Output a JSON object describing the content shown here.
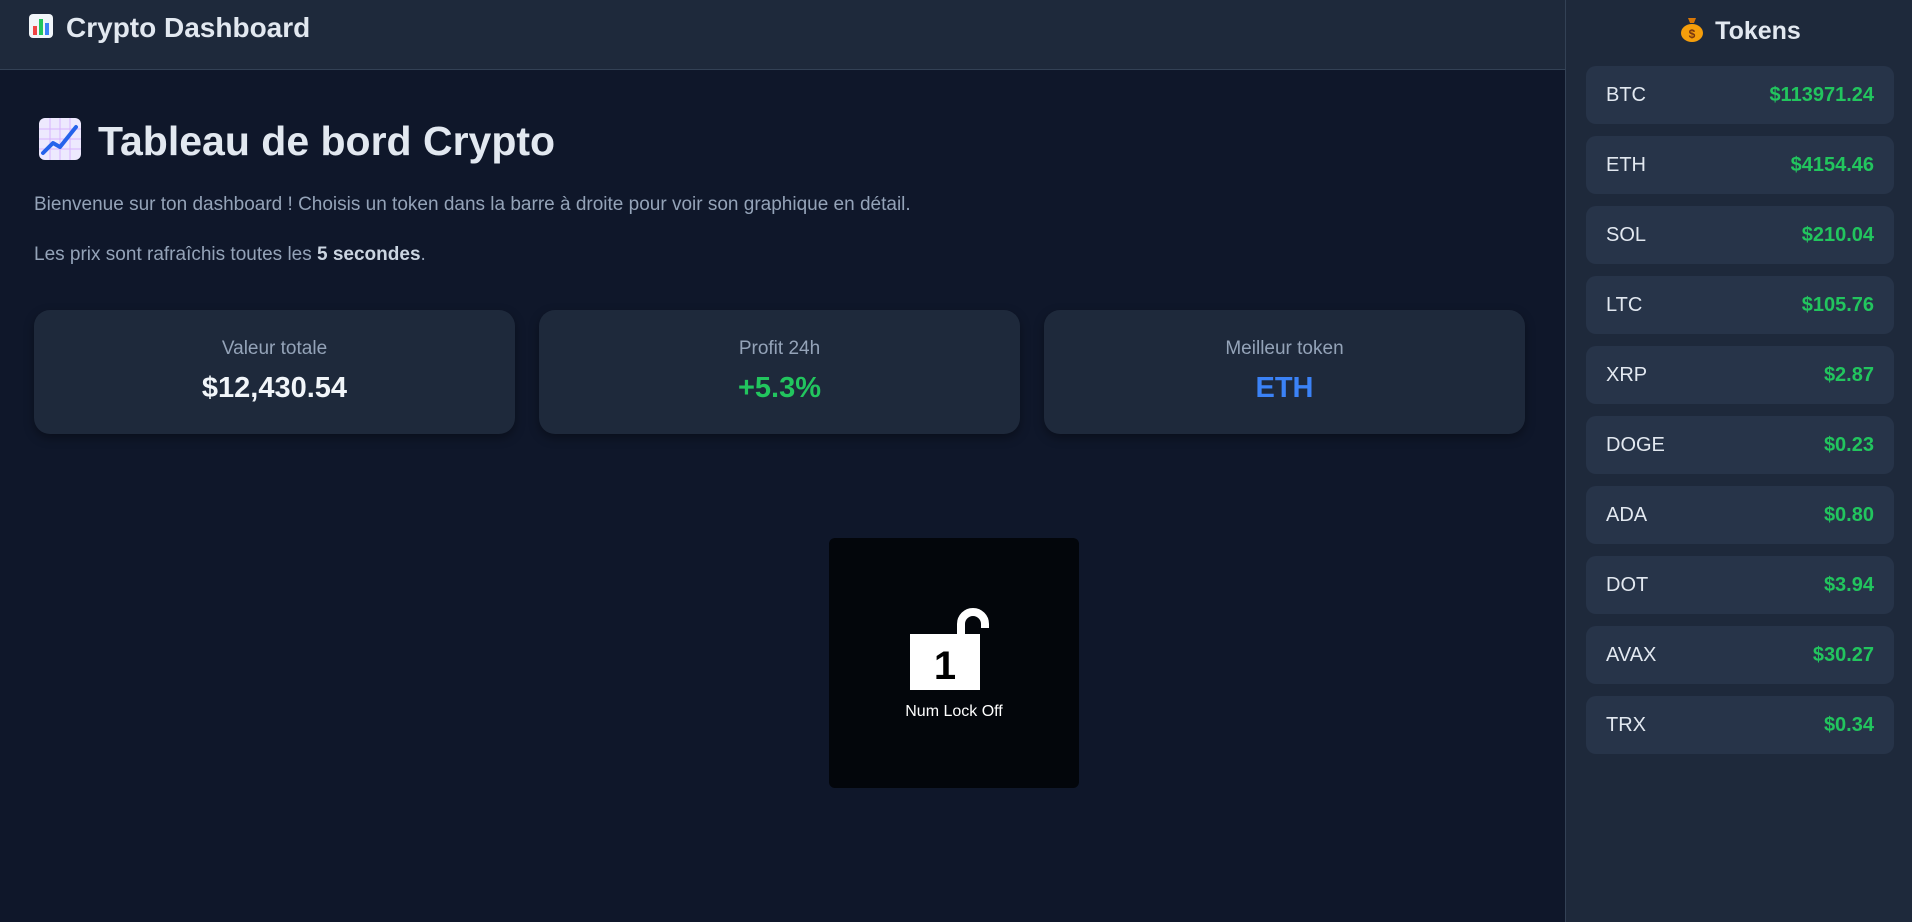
{
  "header": {
    "icon": "bar-chart-emoji",
    "title": "Crypto Dashboard"
  },
  "main": {
    "title_icon": "chart-increasing-emoji",
    "title": "Tableau de bord Crypto",
    "intro": "Bienvenue sur ton dashboard ! Choisis un token dans la barre à droite pour voir son graphique en détail.",
    "refresh_prefix": "Les prix sont rafraîchis toutes les ",
    "refresh_bold": "5 secondes",
    "refresh_suffix": "."
  },
  "stats": [
    {
      "label": "Valeur totale",
      "value": "$12,430.54",
      "color": "#f1f5f9"
    },
    {
      "label": "Profit 24h",
      "value": "+5.3%",
      "color": "#22c55e"
    },
    {
      "label": "Meilleur token",
      "value": "ETH",
      "color": "#3b82f6"
    }
  ],
  "sidebar": {
    "icon": "money-bag-emoji",
    "title": "Tokens",
    "tokens": [
      {
        "symbol": "BTC",
        "price": "$113971.24"
      },
      {
        "symbol": "ETH",
        "price": "$4154.46"
      },
      {
        "symbol": "SOL",
        "price": "$210.04"
      },
      {
        "symbol": "LTC",
        "price": "$105.76"
      },
      {
        "symbol": "XRP",
        "price": "$2.87"
      },
      {
        "symbol": "DOGE",
        "price": "$0.23"
      },
      {
        "symbol": "ADA",
        "price": "$0.80"
      },
      {
        "symbol": "DOT",
        "price": "$3.94"
      },
      {
        "symbol": "AVAX",
        "price": "$30.27"
      },
      {
        "symbol": "TRX",
        "price": "$0.34"
      }
    ]
  },
  "osd": {
    "icon": "unlock-icon",
    "digit": "1",
    "text": "Num Lock Off"
  },
  "colors": {
    "background": "#0f172a",
    "panel": "#1e293b",
    "positive": "#22c55e",
    "accent": "#3b82f6"
  }
}
